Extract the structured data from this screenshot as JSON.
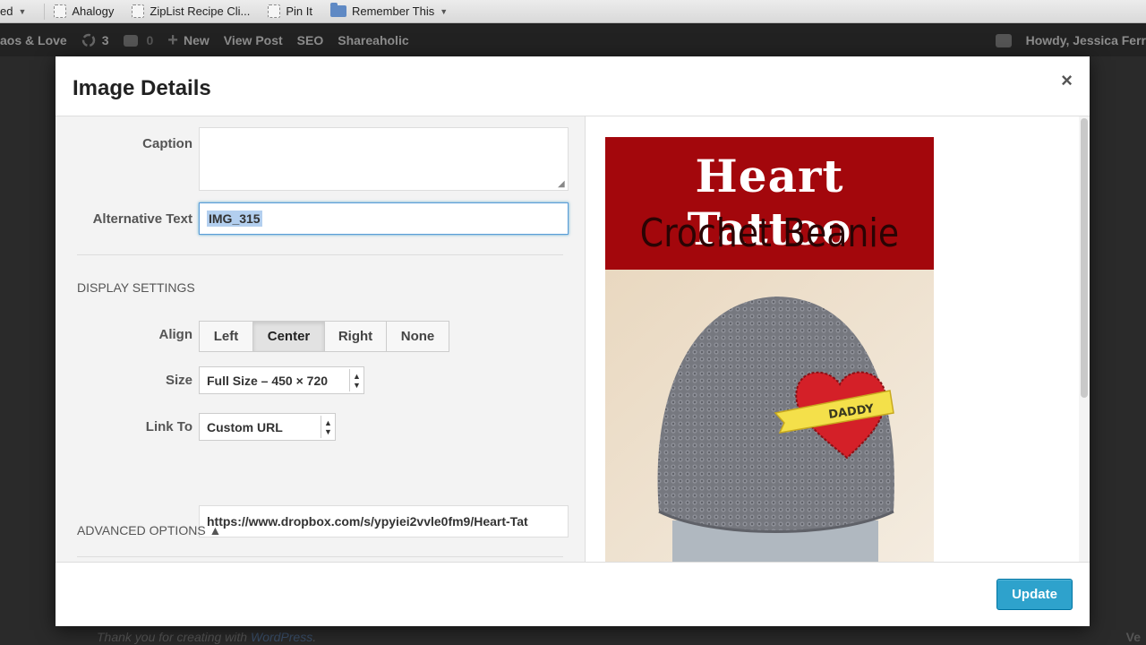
{
  "bookmarks": [
    {
      "label": "ed",
      "type": "caret"
    },
    {
      "label": "Ahalogy",
      "type": "page"
    },
    {
      "label": "ZipList Recipe Cli...",
      "type": "page"
    },
    {
      "label": "Pin It",
      "type": "page"
    },
    {
      "label": "Remember This",
      "type": "folder"
    }
  ],
  "adminbar": {
    "site": "aos & Love",
    "updates_count": "3",
    "comments_count": "0",
    "new_label": "New",
    "view_post": "View Post",
    "seo": "SEO",
    "shareaholic": "Shareaholic",
    "howdy": "Howdy, Jessica Ferr"
  },
  "modal": {
    "title": "Image Details",
    "close": "×"
  },
  "form": {
    "caption_label": "Caption",
    "caption_value": "",
    "alt_label": "Alternative Text",
    "alt_value": "IMG_315",
    "display_settings": "DISPLAY SETTINGS",
    "align_label": "Align",
    "align_options": [
      "Left",
      "Center",
      "Right",
      "None"
    ],
    "align_selected": "Center",
    "size_label": "Size",
    "size_value": "Full Size – 450 × 720",
    "link_label": "Link To",
    "link_value": "Custom URL",
    "url_value": "https://www.dropbox.com/s/ypyiei2vvle0fm9/Heart-Tat",
    "advanced_options": "ADVANCED OPTIONS ▲"
  },
  "preview": {
    "line1": "Heart Tattoo",
    "line2": "Crochet Beanie",
    "banner_text": "DADDY",
    "banner_color": "#a3070c"
  },
  "footer": {
    "update": "Update",
    "thanks": "Thank you for creating with ",
    "wp_link": "WordPress",
    "thanks_end": ".",
    "right_text": "Ve"
  }
}
